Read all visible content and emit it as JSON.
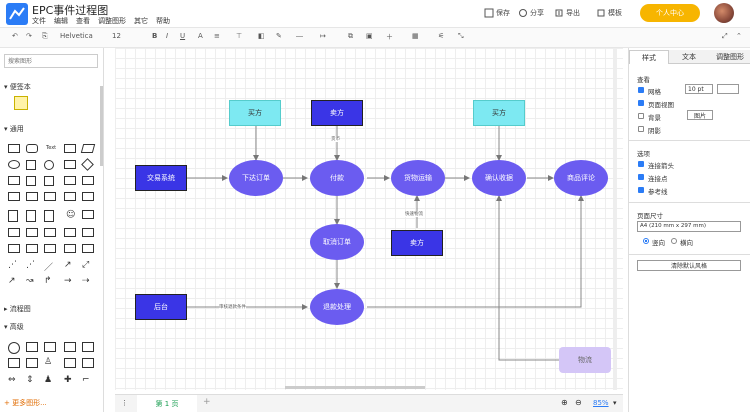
{
  "app": {
    "title": "EPC事件过程图"
  },
  "menu": [
    "文件",
    "编辑",
    "查看",
    "调整图形",
    "其它",
    "帮助"
  ],
  "topbar": {
    "save": "保存",
    "share": "分享",
    "export": "导出",
    "template": "模板",
    "vip": "个人中心"
  },
  "toolbar": {
    "font": "Helvetica",
    "size": "12"
  },
  "left": {
    "search_placeholder": "搜索图形",
    "sections": [
      "便签本",
      "通用",
      "流程图",
      "高级"
    ],
    "more": "+ 更多图形..."
  },
  "diagram": {
    "nodes": {
      "buyer1": "买方",
      "seller1": "卖方",
      "buyer2": "买方",
      "trade": "交易系统",
      "order": "下达订单",
      "pay": "付款",
      "ship": "货物运输",
      "confirm": "确认收据",
      "review": "商品评论",
      "cancel": "取消订单",
      "seller2": "卖方",
      "backend": "后台",
      "refund": "退款处理",
      "logistics": "物流"
    },
    "edge_labels": {
      "pay_label": "货币",
      "ship_label": "快速物流",
      "backend_label": "审核退款条件"
    }
  },
  "right": {
    "tabs": [
      "样式",
      "文本",
      "调整图形"
    ],
    "view_title": "查看",
    "view_opts": [
      "网格",
      "页面视图",
      "背景",
      "阴影"
    ],
    "grid_size": "10 pt",
    "image_btn": "图片",
    "options_title": "选项",
    "options": [
      "连接箭头",
      "连接点",
      "参考线"
    ],
    "page_size_title": "页面尺寸",
    "page_size": "A4 (210 mm x 297 mm)",
    "orientation": [
      "竖向",
      "横向"
    ],
    "reset_btn": "清除默认风格"
  },
  "bottom": {
    "page_tab": "第 1 页",
    "zoom": "85%"
  },
  "colors": {
    "primary": "#2b7cf6",
    "vip": "#f7b500",
    "event": "#6b5cf0",
    "func": "#3a35e6",
    "aqua": "#7de9f2",
    "lavender": "#d4c6f7"
  }
}
